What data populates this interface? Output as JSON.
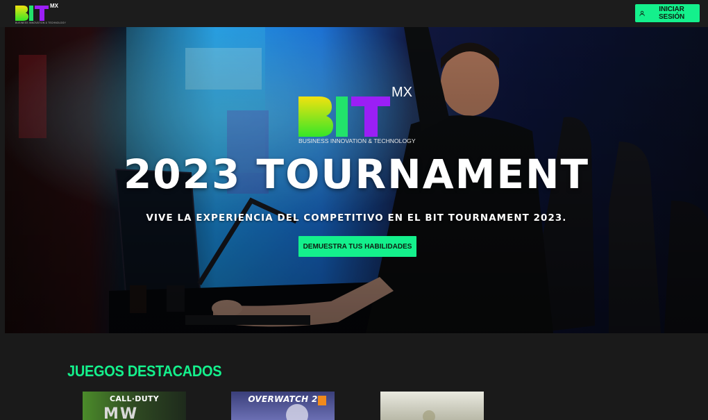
{
  "brand": {
    "logo_letters": [
      "B",
      "I",
      "T"
    ],
    "logo_sup": "MX",
    "logo_tagline": "BUSINESS INNOVATION & TECHNOLOGY",
    "colors": {
      "b": "#f2e20f",
      "b2": "#35e628",
      "i": "#22e36b",
      "t": "#9b1ff5",
      "accent": "#14f08c"
    }
  },
  "header": {
    "login_label": "INICIAR SESIÓN",
    "login_icon": "user-icon"
  },
  "hero": {
    "logo_sup": "MX",
    "logo_tagline": "BUSINESS INNOVATION & TECHNOLOGY",
    "title": "2023 TOURNAMENT",
    "subtitle": "VIVE LA EXPERIENCIA DEL COMPETITIVO EN EL BIT TOURNAMENT 2023.",
    "cta_label": "DEMUESTRA TUS HABILIDADES"
  },
  "featured": {
    "title": "JUEGOS DESTACADOS",
    "games": [
      {
        "label": "CALL·DUTY"
      },
      {
        "label": "OVERWATCH 2"
      },
      {
        "label": ""
      }
    ]
  }
}
